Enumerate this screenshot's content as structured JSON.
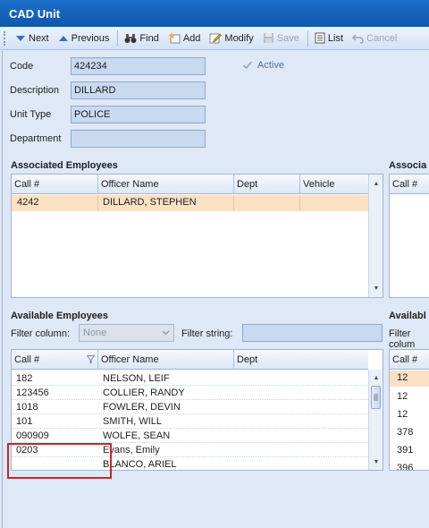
{
  "window": {
    "title": "CAD Unit"
  },
  "toolbar": {
    "next": "Next",
    "previous": "Previous",
    "find": "Find",
    "add": "Add",
    "modify": "Modify",
    "save": "Save",
    "list": "List",
    "cancel": "Cancel"
  },
  "form": {
    "code_label": "Code",
    "code_value": "424234",
    "description_label": "Description",
    "description_value": "DILLARD",
    "unit_type_label": "Unit Type",
    "unit_type_value": "POLICE",
    "department_label": "Department",
    "department_value": "",
    "active_label": "Active",
    "active_checked": true
  },
  "associated_employees": {
    "title": "Associated Employees",
    "columns": [
      "Call #",
      "Officer Name",
      "Dept",
      "Vehicle"
    ],
    "rows": [
      {
        "call": "4242",
        "name": "DILLARD, STEPHEN",
        "dept": "",
        "vehicle": ""
      }
    ]
  },
  "associated_right": {
    "title": "Associa",
    "columns": [
      "Call #"
    ]
  },
  "available_employees": {
    "title": "Available Employees",
    "filter_column_label": "Filter column:",
    "filter_column_value": "None",
    "filter_string_label": "Filter string:",
    "filter_string_value": "",
    "columns": [
      "Call #",
      "Officer Name",
      "Dept"
    ],
    "rows": [
      {
        "call": "182",
        "name": "NELSON, LEIF",
        "dept": ""
      },
      {
        "call": "123456",
        "name": "COLLIER, RANDY",
        "dept": ""
      },
      {
        "call": "1018",
        "name": "FOWLER, DEVIN",
        "dept": ""
      },
      {
        "call": "101",
        "name": "SMITH, WILL",
        "dept": ""
      },
      {
        "call": "090909",
        "name": "WOLFE, SEAN",
        "dept": ""
      },
      {
        "call": "0203",
        "name": "Evans, Emily",
        "dept": ""
      },
      {
        "call": "",
        "name": "BLANCO, ARIEL",
        "dept": ""
      }
    ]
  },
  "available_right": {
    "title": "Availabl",
    "filter_label": "Filter colum",
    "columns": [
      "Call #"
    ],
    "rows": [
      "12",
      "12",
      "12",
      "378",
      "391",
      "396"
    ]
  },
  "colors": {
    "title_bar": "#1565c0",
    "selected_row": "#fbe0c3",
    "highlight_box": "#c9252b"
  }
}
